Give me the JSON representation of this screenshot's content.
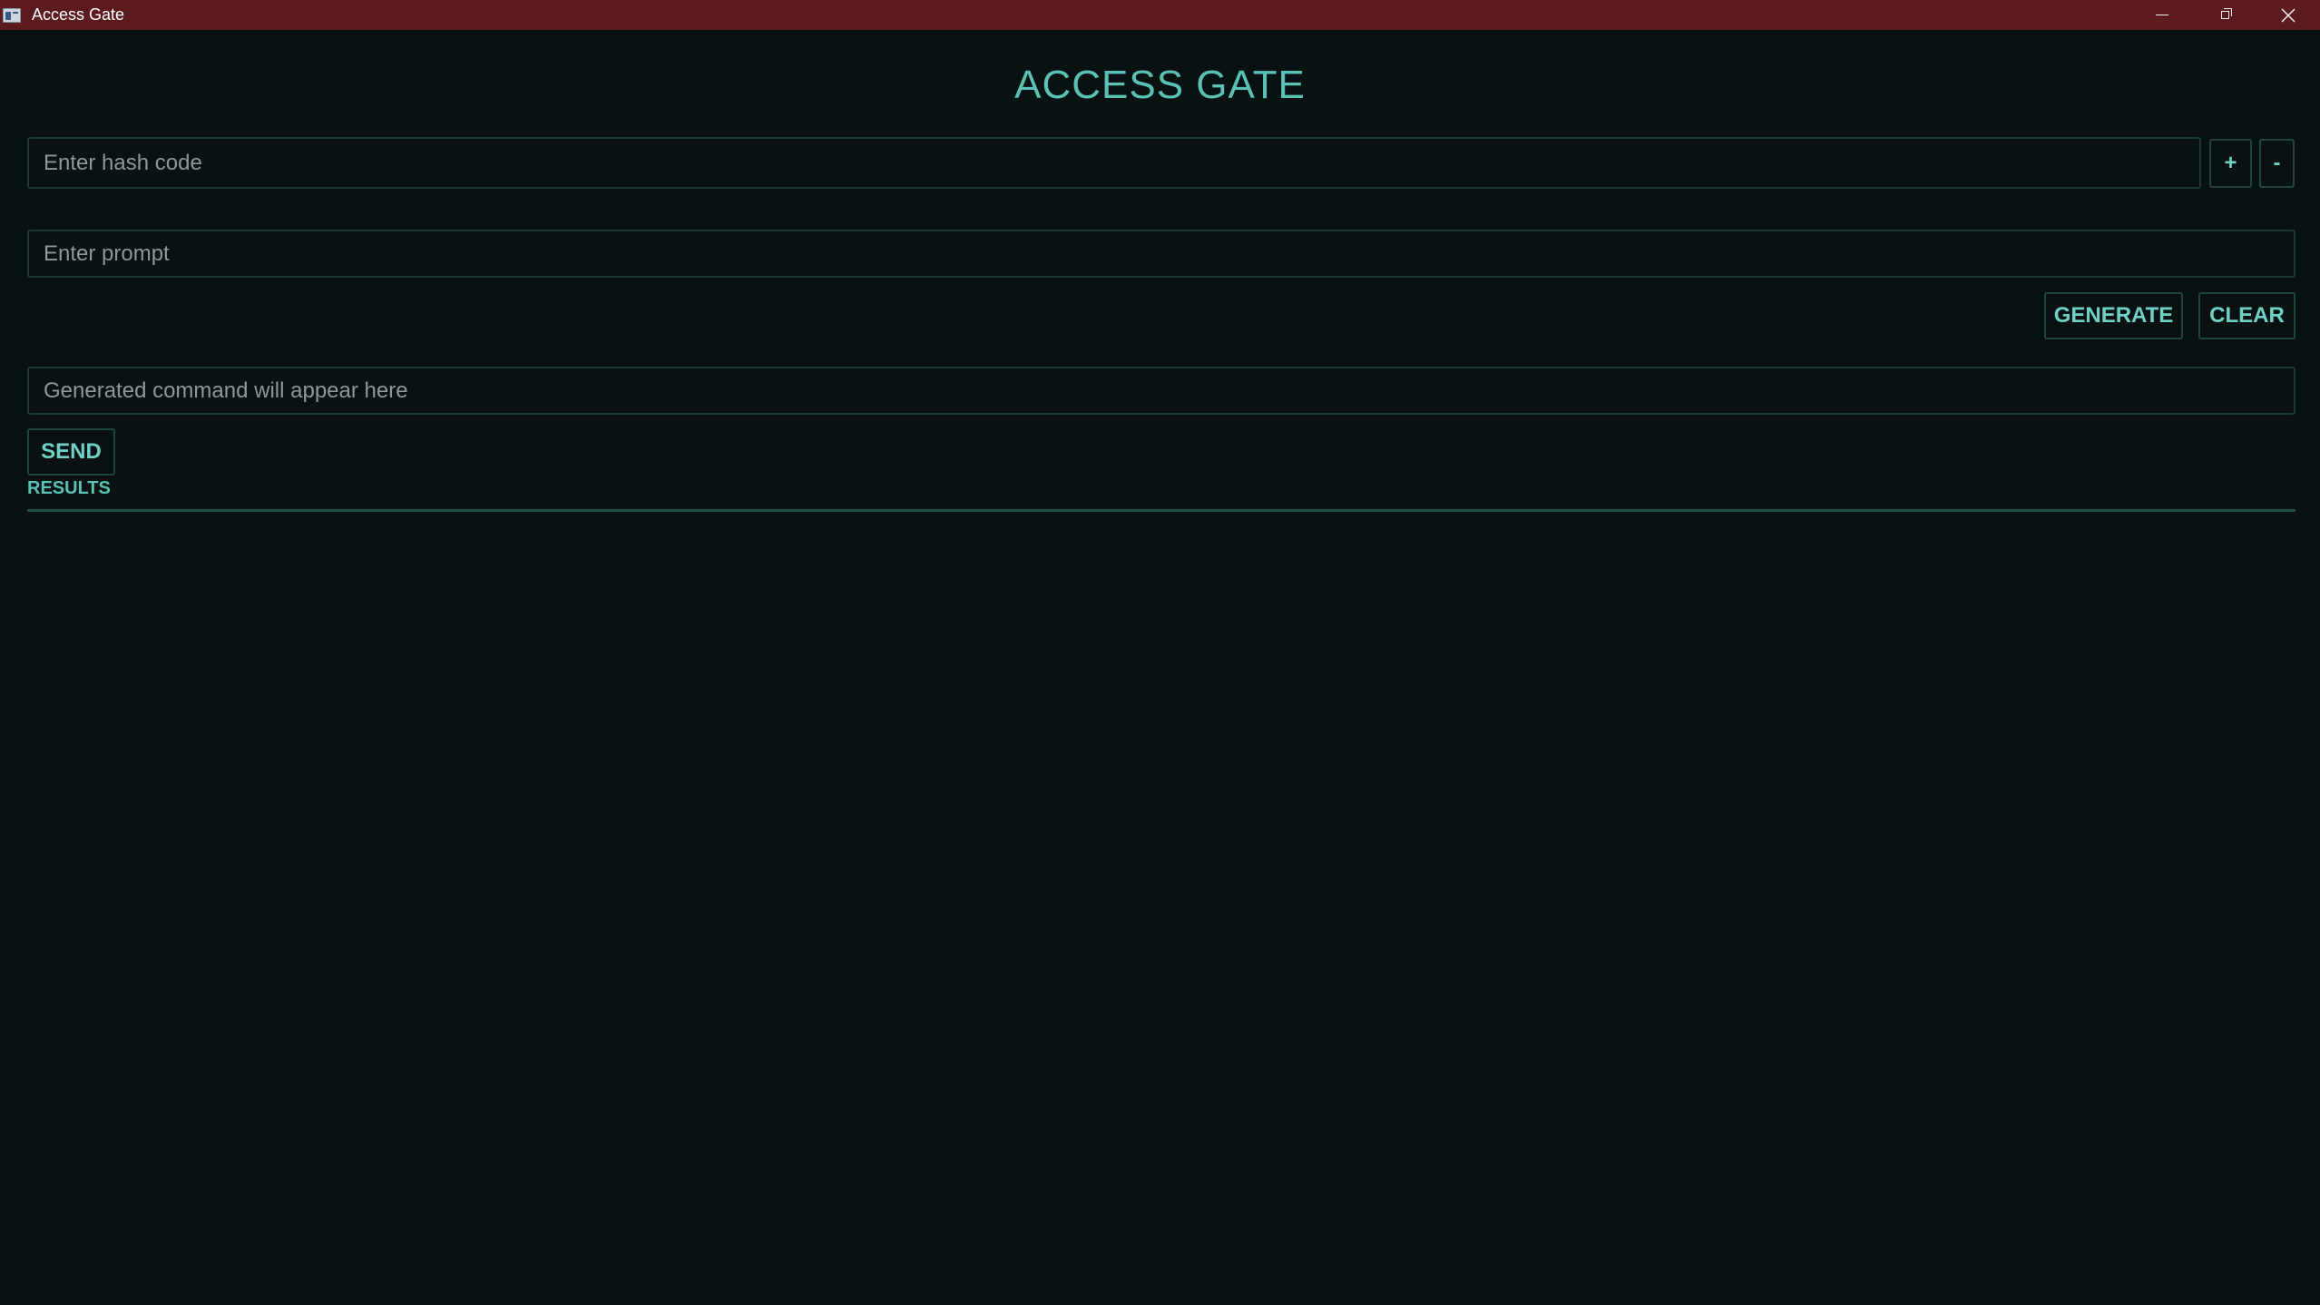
{
  "window": {
    "title": "Access Gate"
  },
  "page": {
    "title": "ACCESS GATE"
  },
  "hash": {
    "placeholder": "Enter hash code",
    "increment_label": "+",
    "decrement_label": "-"
  },
  "prompt": {
    "placeholder": "Enter prompt"
  },
  "actions": {
    "generate_label": "GENERATE",
    "clear_label": "CLEAR"
  },
  "command": {
    "placeholder": "Generated command will appear here",
    "send_label": "SEND"
  },
  "results": {
    "label": "RESULTS"
  },
  "colors": {
    "titlebar": "#5c1c1f",
    "background": "#0a1112",
    "accent": "#59c2b5",
    "border": "#1c3a37"
  },
  "icons": {
    "app": "app-window-icon",
    "minimize": "minimize-icon",
    "maximize": "restore-icon",
    "close": "close-icon"
  }
}
